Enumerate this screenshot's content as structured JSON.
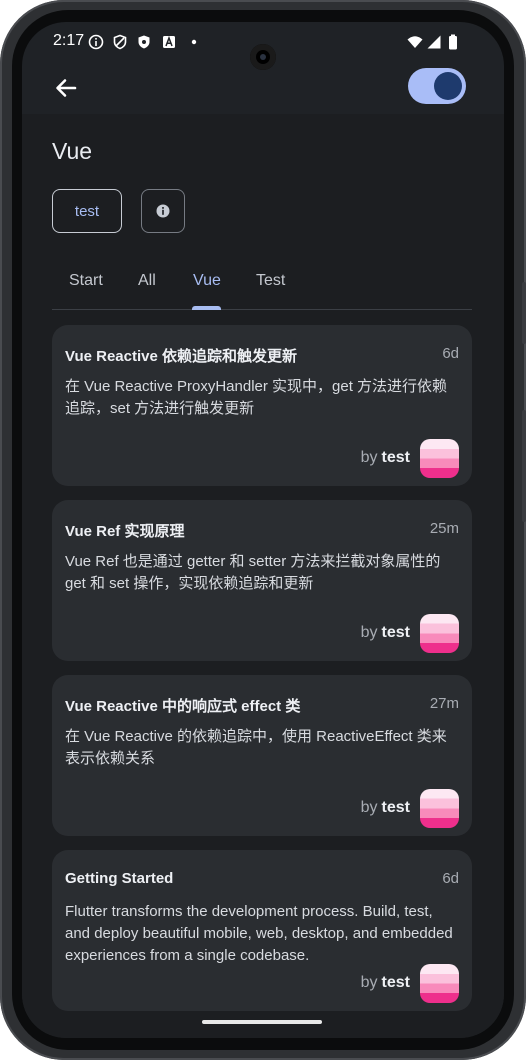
{
  "status_bar": {
    "time": "2:17",
    "left_icons": [
      "info-circle-icon",
      "shield-outline-icon",
      "shield-filled-icon",
      "a-box-icon",
      "dot-icon"
    ],
    "right_icons": [
      "wifi-icon",
      "cell-signal-icon",
      "battery-icon"
    ]
  },
  "app_bar": {
    "back_icon": "arrow-left-icon",
    "theme_toggle_on": true
  },
  "page": {
    "title": "Vue",
    "tag_button_label": "test",
    "info_icon": "info-icon"
  },
  "tabs": [
    {
      "label": "Start",
      "active": false
    },
    {
      "label": "All",
      "active": false
    },
    {
      "label": "Vue",
      "active": true
    },
    {
      "label": "Test",
      "active": false
    }
  ],
  "posts": [
    {
      "title": "Vue Reactive 依赖追踪和触发更新",
      "time": "6d",
      "body": "在 Vue Reactive ProxyHandler 实现中，get 方法进行依赖追踪，set 方法进行触发更新",
      "by_label": "by",
      "author": "test"
    },
    {
      "title": "Vue Ref 实现原理",
      "time": "25m",
      "body": "Vue Ref 也是通过 getter 和 setter 方法来拦截对象属性的 get 和 set 操作，实现依赖追踪和更新",
      "by_label": "by",
      "author": "test"
    },
    {
      "title": "Vue Reactive 中的响应式 effect 类",
      "time": "27m",
      "body": "在 Vue Reactive 的依赖追踪中，使用 ReactiveEffect 类来表示依赖关系",
      "by_label": "by",
      "author": "test"
    },
    {
      "title": "Getting Started",
      "time": "6d",
      "body": "Flutter transforms the development process. Build, test, and deploy beautiful mobile, web, desktop, and embedded experiences from a single codebase.",
      "by_label": "by",
      "author": "test"
    }
  ],
  "colors": {
    "accent": "#a8bdf2",
    "background": "#1c1e21",
    "card": "#2a2d31"
  }
}
